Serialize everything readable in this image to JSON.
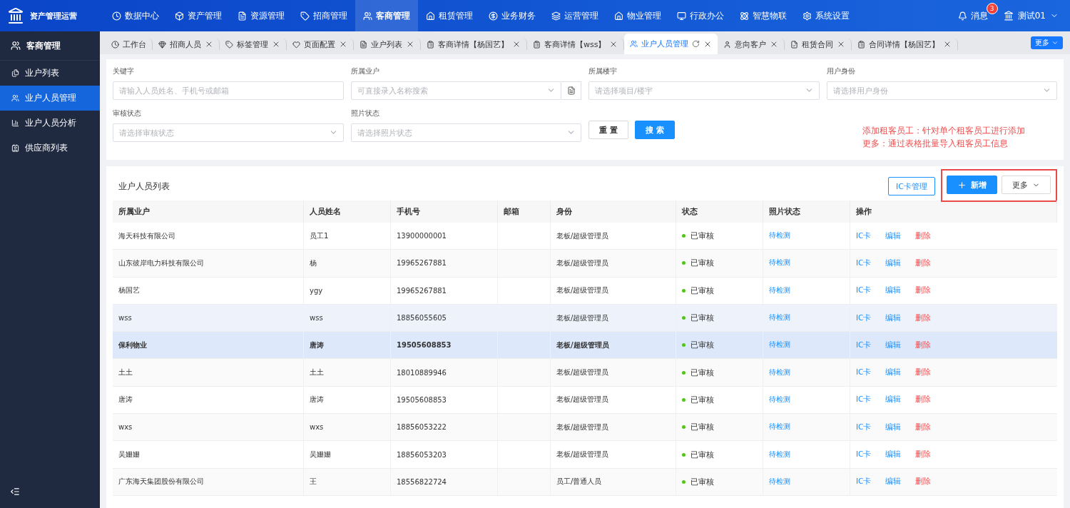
{
  "app": {
    "title": "资产管理运营"
  },
  "top_nav": [
    {
      "label": "数据中心",
      "selected": false
    },
    {
      "label": "资产管理",
      "selected": false
    },
    {
      "label": "资源管理",
      "selected": false
    },
    {
      "label": "招商管理",
      "selected": false
    },
    {
      "label": "客商管理",
      "selected": true
    },
    {
      "label": "租赁管理",
      "selected": false
    },
    {
      "label": "业务财务",
      "selected": false
    },
    {
      "label": "运营管理",
      "selected": false
    },
    {
      "label": "物业管理",
      "selected": false
    },
    {
      "label": "行政办公",
      "selected": false
    },
    {
      "label": "智慧物联",
      "selected": false
    },
    {
      "label": "系统设置",
      "selected": false
    }
  ],
  "user": {
    "messages": "消息",
    "badge": "3",
    "name": "测试01"
  },
  "tabs": [
    {
      "label": "工作台",
      "selected": false,
      "closable": false
    },
    {
      "label": "招商人员",
      "selected": false,
      "closable": true
    },
    {
      "label": "标签管理",
      "selected": false,
      "closable": true
    },
    {
      "label": "页面配置",
      "selected": false,
      "closable": true
    },
    {
      "label": "业户列表",
      "selected": false,
      "closable": true
    },
    {
      "label": "客商详情【杨国艺】",
      "selected": false,
      "closable": true
    },
    {
      "label": "客商详情【wss】",
      "selected": false,
      "closable": true
    },
    {
      "label": "业户人员管理",
      "selected": true,
      "closable": true
    },
    {
      "label": "意向客户",
      "selected": false,
      "closable": true
    },
    {
      "label": "租赁合同",
      "selected": false,
      "closable": true
    },
    {
      "label": "合同详情【杨国艺】",
      "selected": false,
      "closable": true
    }
  ],
  "tabs_more": "更多",
  "sidebar": {
    "title": "客商管理",
    "items": [
      {
        "label": "业户列表",
        "selected": false
      },
      {
        "label": "业户人员管理",
        "selected": true
      },
      {
        "label": "业户人员分析",
        "selected": false
      },
      {
        "label": "供应商列表",
        "selected": false
      }
    ]
  },
  "filters": [
    {
      "label": "关键字",
      "placeholder": "请输入人员姓名、手机号或邮箱",
      "kind": "input"
    },
    {
      "label": "所属业户",
      "placeholder": "可直接录入名称搜索",
      "kind": "select_button"
    },
    {
      "label": "所属楼宇",
      "placeholder": "请选择项目/楼宇",
      "kind": "select"
    },
    {
      "label": "用户身份",
      "placeholder": "请选择用户身份",
      "kind": "select"
    },
    {
      "label": "审核状态",
      "placeholder": "请选择审核状态",
      "kind": "select"
    },
    {
      "label": "照片状态",
      "placeholder": "请选择照片状态",
      "kind": "select"
    }
  ],
  "filter_buttons": {
    "reset": "重 置",
    "search": "搜 索"
  },
  "note": [
    "添加租客员工：针对单个租客员工进行添加",
    "更多：通过表格批量导入租客员工信息"
  ],
  "table": {
    "title": "业户人员列表",
    "ic_button": "IC卡管理",
    "add_button": "新增",
    "more_button": "更多",
    "columns": [
      "所属业户",
      "人员姓名",
      "手机号",
      "邮箱",
      "身份",
      "状态",
      "照片状态",
      "操作"
    ],
    "rows": [
      {
        "owner": "海天科技有限公司",
        "name": "员工1",
        "phone": "13900000001",
        "role": "老板/超级管理员",
        "status": "已审核",
        "photo": "待检测",
        "actions": [
          "IC卡",
          "编辑",
          "删除"
        ],
        "selected": false,
        "hovered": false
      },
      {
        "owner": "山东彼岸电力科技有限公司",
        "name": "杨",
        "phone": "19965267881",
        "role": "老板/超级管理员",
        "status": "已审核",
        "photo": "待检测",
        "actions": [
          "IC卡",
          "编辑",
          "删除"
        ],
        "selected": false,
        "hovered": false
      },
      {
        "owner": "杨国艺",
        "name": "ygy",
        "phone": "19965267881",
        "role": "老板/超级管理员",
        "status": "已审核",
        "photo": "待检测",
        "actions": [
          "IC卡",
          "编辑",
          "删除"
        ],
        "selected": false,
        "hovered": false
      },
      {
        "owner": "wss",
        "name": "wss",
        "phone": "18856055605",
        "role": "老板/超级管理员",
        "status": "已审核",
        "photo": "待检测",
        "actions": [
          "IC卡",
          "编辑",
          "删除"
        ],
        "selected": false,
        "hovered": true
      },
      {
        "owner": "保利物业",
        "name": "唐涛",
        "phone": "19505608853",
        "role": "老板/超级管理员",
        "status": "已审核",
        "photo": "待检测",
        "actions": [
          "IC卡",
          "编辑",
          "删除"
        ],
        "selected": true,
        "hovered": false
      },
      {
        "owner": "土土",
        "name": "土土",
        "phone": "18010889946",
        "role": "老板/超级管理员",
        "status": "已审核",
        "photo": "待检测",
        "actions": [
          "IC卡",
          "编辑",
          "删除"
        ],
        "selected": false,
        "hovered": false
      },
      {
        "owner": "唐涛",
        "name": "唐涛",
        "phone": "19505608853",
        "role": "老板/超级管理员",
        "status": "已审核",
        "photo": "待检测",
        "actions": [
          "IC卡",
          "编辑",
          "删除"
        ],
        "selected": false,
        "hovered": false
      },
      {
        "owner": "wxs",
        "name": "wxs",
        "phone": "18856053222",
        "role": "老板/超级管理员",
        "status": "已审核",
        "photo": "待检测",
        "actions": [
          "IC卡",
          "编辑",
          "删除"
        ],
        "selected": false,
        "hovered": false
      },
      {
        "owner": "吴姗姗",
        "name": "吴姗姗",
        "phone": "18856053203",
        "role": "老板/超级管理员",
        "status": "已审核",
        "photo": "待检测",
        "actions": [
          "IC卡",
          "编辑",
          "删除"
        ],
        "selected": false,
        "hovered": false
      },
      {
        "owner": "广东海天集团股份有限公司",
        "name": "王",
        "phone": "18556822724",
        "role": "员工/普通人员",
        "status": "已审核",
        "photo": "待检测",
        "actions": [
          "IC卡",
          "编辑",
          "删除"
        ],
        "selected": false,
        "hovered": false
      }
    ]
  }
}
